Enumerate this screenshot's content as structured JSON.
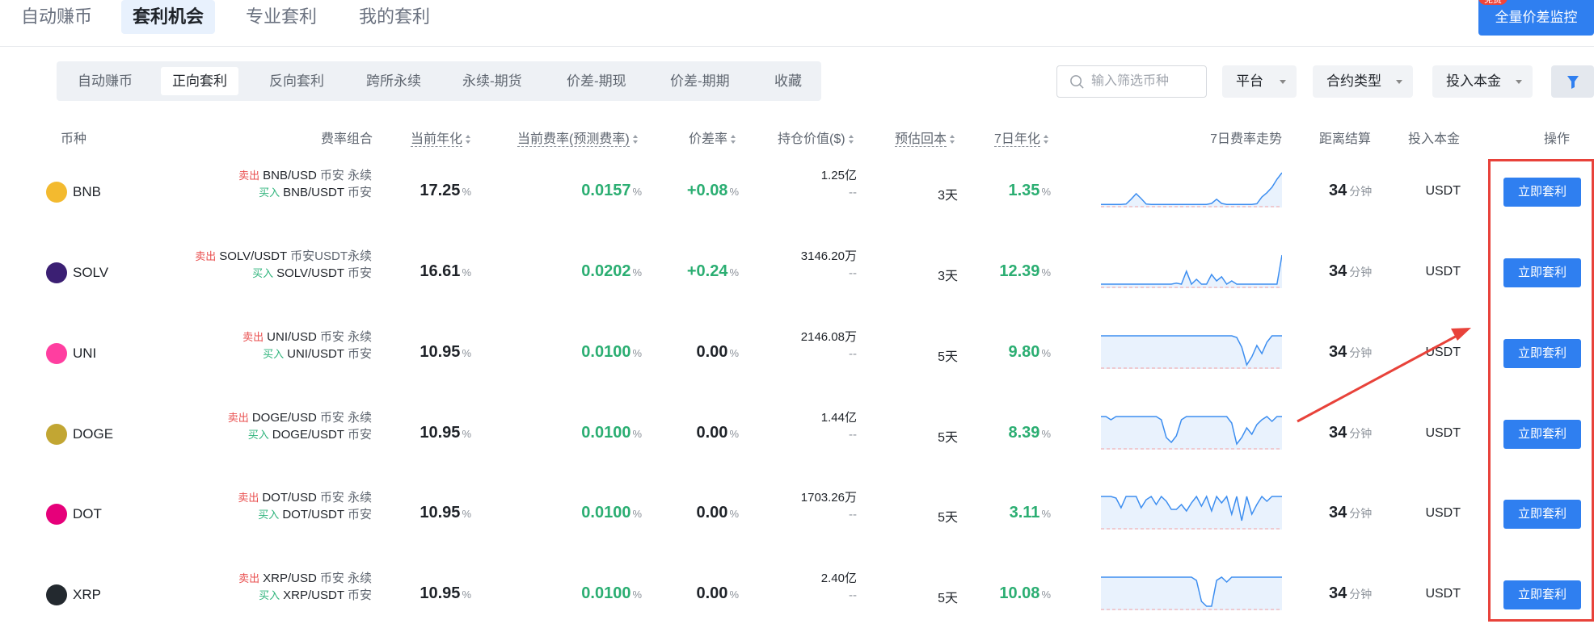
{
  "nav": {
    "tabs": [
      {
        "label": "自动赚币"
      },
      {
        "label": "套利机会"
      },
      {
        "label": "专业套利"
      },
      {
        "label": "我的套利"
      }
    ],
    "monitor_button": "全量价差监控",
    "badge": "免费"
  },
  "subtabs": [
    "自动赚币",
    "正向套利",
    "反向套利",
    "跨所永续",
    "永续-期货",
    "价差-期现",
    "价差-期期",
    "收藏"
  ],
  "filters": {
    "search_placeholder": "输入筛选币种",
    "platform": "平台",
    "contract_type": "合约类型",
    "capital": "投入本金"
  },
  "columns": {
    "coin": "币种",
    "combo": "费率组合",
    "annual": "当前年化",
    "rate": "当前费率(预测费率)",
    "spread": "价差率",
    "holding": "持仓价值($)",
    "payback": "预估回本",
    "annual7": "7日年化",
    "trend": "7日费率走势",
    "settle": "距离结算",
    "capital": "投入本金",
    "action": "操作"
  },
  "labels": {
    "sell": "卖出",
    "buy": "买入",
    "pct": "%",
    "minutes": "分钟",
    "dash": "--",
    "action_button": "立即套利"
  },
  "colors": {
    "accent": "#2f7ff0",
    "green": "#2bae72",
    "red": "#e94f4f",
    "annotation": "#e8423a"
  },
  "rows": [
    {
      "coin": "BNB",
      "icon_color": "#f3ba2f",
      "sell_pair": "BNB/USD",
      "sell_ex": "币安 永续",
      "buy_pair": "BNB/USDT",
      "buy_ex": "币安",
      "annual": "17.25",
      "rate": "0.0157",
      "spread": "+0.08",
      "spread_green": true,
      "holding": "1.25亿",
      "payback": "3天",
      "annual7": "1.35",
      "settle": "34",
      "capital": "USDT",
      "trend": [
        0.02,
        0.02,
        0.02,
        0.02,
        0.02,
        0.03,
        0.18,
        0.35,
        0.2,
        0.03,
        0.02,
        0.02,
        0.02,
        0.02,
        0.02,
        0.02,
        0.02,
        0.02,
        0.02,
        0.02,
        0.02,
        0.02,
        0.05,
        0.18,
        0.05,
        0.02,
        0.02,
        0.02,
        0.02,
        0.02,
        0.02,
        0.04,
        0.25,
        0.38,
        0.55,
        0.8,
        1.0
      ]
    },
    {
      "coin": "SOLV",
      "icon_color": "#3b1f73",
      "sell_pair": "SOLV/USDT",
      "sell_ex": "币安USDT永续",
      "buy_pair": "SOLV/USDT",
      "buy_ex": "币安",
      "annual": "16.61",
      "rate": "0.0202",
      "spread": "+0.24",
      "spread_green": true,
      "holding": "3146.20万",
      "payback": "3天",
      "annual7": "12.39",
      "settle": "34",
      "capital": "USDT",
      "trend": [
        0.05,
        0.05,
        0.05,
        0.05,
        0.05,
        0.05,
        0.05,
        0.05,
        0.05,
        0.05,
        0.05,
        0.05,
        0.05,
        0.05,
        0.05,
        0.08,
        0.05,
        0.45,
        0.05,
        0.2,
        0.05,
        0.05,
        0.35,
        0.15,
        0.28,
        0.05,
        0.15,
        0.05,
        0.05,
        0.05,
        0.05,
        0.05,
        0.05,
        0.05,
        0.05,
        0.05,
        0.95
      ]
    },
    {
      "coin": "UNI",
      "icon_color": "#ff3ea0",
      "sell_pair": "UNI/USD",
      "sell_ex": "币安 永续",
      "buy_pair": "UNI/USDT",
      "buy_ex": "币安",
      "annual": "10.95",
      "rate": "0.0100",
      "spread": "0.00",
      "spread_green": false,
      "holding": "2146.08万",
      "payback": "5天",
      "annual7": "9.80",
      "settle": "34",
      "capital": "USDT",
      "trend": [
        0.95,
        0.95,
        0.95,
        0.95,
        0.95,
        0.95,
        0.95,
        0.95,
        0.95,
        0.95,
        0.95,
        0.95,
        0.95,
        0.95,
        0.95,
        0.95,
        0.95,
        0.95,
        0.95,
        0.95,
        0.95,
        0.95,
        0.95,
        0.95,
        0.95,
        0.95,
        0.95,
        0.9,
        0.6,
        0.05,
        0.3,
        0.65,
        0.4,
        0.75,
        0.95,
        0.95,
        0.95
      ]
    },
    {
      "coin": "DOGE",
      "icon_color": "#c2a633",
      "sell_pair": "DOGE/USD",
      "sell_ex": "币安 永续",
      "buy_pair": "DOGE/USDT",
      "buy_ex": "币安",
      "annual": "10.95",
      "rate": "0.0100",
      "spread": "0.00",
      "spread_green": false,
      "holding": "1.44亿",
      "payback": "5天",
      "annual7": "8.39",
      "settle": "34",
      "capital": "USDT",
      "trend": [
        0.95,
        0.95,
        0.85,
        0.95,
        0.95,
        0.95,
        0.95,
        0.95,
        0.95,
        0.95,
        0.95,
        0.95,
        0.85,
        0.3,
        0.15,
        0.35,
        0.85,
        0.95,
        0.95,
        0.95,
        0.95,
        0.95,
        0.95,
        0.95,
        0.95,
        0.95,
        0.75,
        0.1,
        0.3,
        0.6,
        0.4,
        0.7,
        0.85,
        0.95,
        0.8,
        0.95,
        0.95
      ]
    },
    {
      "coin": "DOT",
      "icon_color": "#e6007a",
      "sell_pair": "DOT/USD",
      "sell_ex": "币安 永续",
      "buy_pair": "DOT/USDT",
      "buy_ex": "币安",
      "annual": "10.95",
      "rate": "0.0100",
      "spread": "0.00",
      "spread_green": false,
      "holding": "1703.26万",
      "payback": "5天",
      "annual7": "3.11",
      "settle": "34",
      "capital": "USDT",
      "trend": [
        0.95,
        0.95,
        0.95,
        0.9,
        0.6,
        0.95,
        0.95,
        0.95,
        0.6,
        0.85,
        0.95,
        0.7,
        0.95,
        0.8,
        0.55,
        0.55,
        0.7,
        0.5,
        0.75,
        0.95,
        0.65,
        0.95,
        0.5,
        0.95,
        0.75,
        0.95,
        0.4,
        0.95,
        0.2,
        0.95,
        0.4,
        0.7,
        0.95,
        0.8,
        0.95,
        0.95,
        0.95
      ]
    },
    {
      "coin": "XRP",
      "icon_color": "#23292f",
      "sell_pair": "XRP/USD",
      "sell_ex": "币安 永续",
      "buy_pair": "XRP/USDT",
      "buy_ex": "币安",
      "annual": "10.95",
      "rate": "0.0100",
      "spread": "0.00",
      "spread_green": false,
      "holding": "2.40亿",
      "payback": "5天",
      "annual7": "10.08",
      "settle": "34",
      "capital": "USDT",
      "trend": [
        0.95,
        0.95,
        0.95,
        0.95,
        0.95,
        0.95,
        0.95,
        0.95,
        0.95,
        0.95,
        0.95,
        0.95,
        0.95,
        0.95,
        0.95,
        0.95,
        0.95,
        0.95,
        0.95,
        0.85,
        0.2,
        0.05,
        0.05,
        0.85,
        0.95,
        0.8,
        0.95,
        0.95,
        0.95,
        0.95,
        0.95,
        0.95,
        0.95,
        0.95,
        0.95,
        0.95,
        0.95
      ]
    }
  ]
}
